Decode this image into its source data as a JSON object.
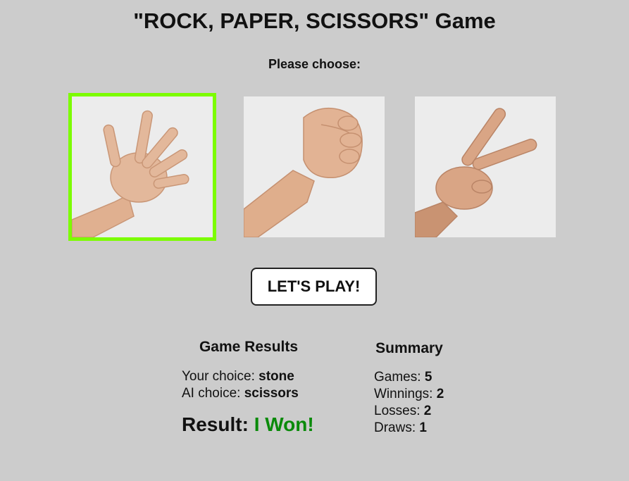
{
  "header": {
    "title": "\"ROCK, PAPER, SCISSORS\" Game",
    "prompt": "Please choose:"
  },
  "choices": [
    {
      "id": "paper",
      "icon": "open-hand-paper-icon",
      "selected": true
    },
    {
      "id": "rock",
      "icon": "fist-rock-icon",
      "selected": false
    },
    {
      "id": "scissors",
      "icon": "two-fingers-scissors-icon",
      "selected": false
    }
  ],
  "play_button": {
    "label": "LET'S PLAY!"
  },
  "results": {
    "heading": "Game Results",
    "your_choice_label": "Your choice:",
    "your_choice_value": "stone",
    "ai_choice_label": "AI choice:",
    "ai_choice_value": "scissors",
    "result_label": "Result:",
    "result_value": "I Won!"
  },
  "summary": {
    "heading": "Summary",
    "games_label": "Games:",
    "games_value": "5",
    "winnings_label": "Winnings:",
    "winnings_value": "2",
    "losses_label": "Losses:",
    "losses_value": "2",
    "draws_label": "Draws:",
    "draws_value": "1"
  },
  "colors": {
    "background": "#cccccc",
    "selected_outline": "#7cfc00",
    "win_text": "#0a8a0a"
  }
}
